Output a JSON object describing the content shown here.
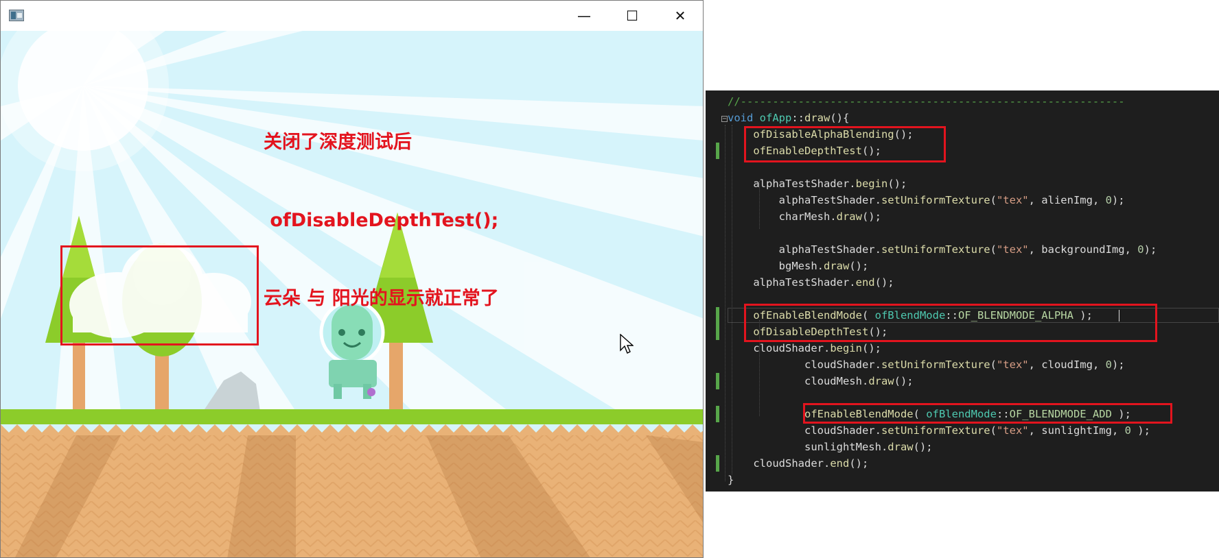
{
  "window": {
    "app_icon": "window-app-icon",
    "controls": {
      "minimize_symbol": "—",
      "maximize_symbol": "☐",
      "close_symbol": "✕"
    }
  },
  "annotation": {
    "lines": [
      "关闭了深度测试后",
      " ofDisableDepthTest();",
      "云朵 与 阳光的显示就正常了"
    ],
    "color": "#e3141e"
  },
  "highlight_color": "#e3141e",
  "scene": {
    "description_free": true,
    "sky_color": "#d6f4fb",
    "ground_color": "#e9b277",
    "grass_color": "#8ccc2a"
  },
  "code": {
    "lines": [
      [
        [
          "//------------------------------------------------------------",
          "c-com"
        ]
      ],
      [
        [
          "void",
          "c-kw"
        ],
        [
          " ",
          "c-txt"
        ],
        [
          "ofApp",
          "c-cls"
        ],
        [
          "::",
          "c-txt"
        ],
        [
          "draw",
          "c-fn"
        ],
        [
          "(){",
          "c-txt"
        ]
      ],
      [
        [
          "    ",
          "c-txt"
        ],
        [
          "ofDisableAlphaBlending",
          "c-fn"
        ],
        [
          "();",
          "c-txt"
        ]
      ],
      [
        [
          "    ",
          "c-txt"
        ],
        [
          "ofEnableDepthTest",
          "c-fn"
        ],
        [
          "();",
          "c-txt"
        ]
      ],
      [
        [
          "",
          "c-txt"
        ]
      ],
      [
        [
          "    alphaTestShader.",
          "c-txt"
        ],
        [
          "begin",
          "c-fn"
        ],
        [
          "();",
          "c-txt"
        ]
      ],
      [
        [
          "        alphaTestShader.",
          "c-txt"
        ],
        [
          "setUniformTexture",
          "c-fn"
        ],
        [
          "(",
          "c-txt"
        ],
        [
          "\"tex\"",
          "c-str"
        ],
        [
          ", alienImg, ",
          "c-txt"
        ],
        [
          "0",
          "c-num"
        ],
        [
          ");",
          "c-txt"
        ]
      ],
      [
        [
          "        charMesh.",
          "c-txt"
        ],
        [
          "draw",
          "c-fn"
        ],
        [
          "();",
          "c-txt"
        ]
      ],
      [
        [
          "",
          "c-txt"
        ]
      ],
      [
        [
          "        alphaTestShader.",
          "c-txt"
        ],
        [
          "setUniformTexture",
          "c-fn"
        ],
        [
          "(",
          "c-txt"
        ],
        [
          "\"tex\"",
          "c-str"
        ],
        [
          ", backgroundImg, ",
          "c-txt"
        ],
        [
          "0",
          "c-num"
        ],
        [
          ");",
          "c-txt"
        ]
      ],
      [
        [
          "        bgMesh.",
          "c-txt"
        ],
        [
          "draw",
          "c-fn"
        ],
        [
          "();",
          "c-txt"
        ]
      ],
      [
        [
          "    alphaTestShader.",
          "c-txt"
        ],
        [
          "end",
          "c-fn"
        ],
        [
          "();",
          "c-txt"
        ]
      ],
      [
        [
          "",
          "c-txt"
        ]
      ],
      [
        [
          "    ",
          "c-txt"
        ],
        [
          "ofEnableBlendMode",
          "c-fn"
        ],
        [
          "( ",
          "c-txt"
        ],
        [
          "ofBlendMode",
          "c-cls"
        ],
        [
          "::",
          "c-txt"
        ],
        [
          "OF_BLENDMODE_ALPHA",
          "c-en"
        ],
        [
          " );",
          "c-txt"
        ]
      ],
      [
        [
          "    ",
          "c-txt"
        ],
        [
          "ofDisableDepthTest",
          "c-fn"
        ],
        [
          "();",
          "c-txt"
        ]
      ],
      [
        [
          "    cloudShader.",
          "c-txt"
        ],
        [
          "begin",
          "c-fn"
        ],
        [
          "();",
          "c-txt"
        ]
      ],
      [
        [
          "            cloudShader.",
          "c-txt"
        ],
        [
          "setUniformTexture",
          "c-fn"
        ],
        [
          "(",
          "c-txt"
        ],
        [
          "\"tex\"",
          "c-str"
        ],
        [
          ", cloudImg, ",
          "c-txt"
        ],
        [
          "0",
          "c-num"
        ],
        [
          ");",
          "c-txt"
        ]
      ],
      [
        [
          "            cloudMesh.",
          "c-txt"
        ],
        [
          "draw",
          "c-fn"
        ],
        [
          "();",
          "c-txt"
        ]
      ],
      [
        [
          "",
          "c-txt"
        ]
      ],
      [
        [
          "            ",
          "c-txt"
        ],
        [
          "ofEnableBlendMode",
          "c-fn"
        ],
        [
          "( ",
          "c-txt"
        ],
        [
          "ofBlendMode",
          "c-cls"
        ],
        [
          "::",
          "c-txt"
        ],
        [
          "OF_BLENDMODE_ADD",
          "c-en"
        ],
        [
          " );",
          "c-txt"
        ]
      ],
      [
        [
          "            cloudShader.",
          "c-txt"
        ],
        [
          "setUniformTexture",
          "c-fn"
        ],
        [
          "(",
          "c-txt"
        ],
        [
          "\"tex\"",
          "c-str"
        ],
        [
          ", sunlightImg, ",
          "c-txt"
        ],
        [
          "0",
          "c-num"
        ],
        [
          " );",
          "c-txt"
        ]
      ],
      [
        [
          "            sunlightMesh.",
          "c-txt"
        ],
        [
          "draw",
          "c-fn"
        ],
        [
          "();",
          "c-txt"
        ]
      ],
      [
        [
          "    cloudShader.",
          "c-txt"
        ],
        [
          "end",
          "c-fn"
        ],
        [
          "();",
          "c-txt"
        ]
      ],
      [
        [
          "}",
          "c-txt"
        ]
      ]
    ],
    "colors": {
      "background": "#1e1e1e",
      "comment": "#57a64a",
      "keyword": "#569cd6",
      "class": "#4ec9b0",
      "function": "#dcdcaa",
      "string": "#d69d85",
      "number": "#b5cea8",
      "enum": "#b8d7a3"
    }
  }
}
